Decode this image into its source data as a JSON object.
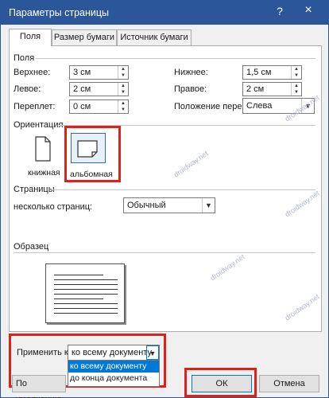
{
  "window": {
    "title": "Параметры страницы",
    "help_glyph": "?",
    "close_glyph": "×"
  },
  "tabs": [
    {
      "label": "Поля",
      "active": true
    },
    {
      "label": "Размер бумаги",
      "active": false
    },
    {
      "label": "Источник бумаги",
      "active": false
    }
  ],
  "margins": {
    "section_label": "Поля",
    "top_label": "Верхнее:",
    "top_value": "3 см",
    "bottom_label": "Нижнее:",
    "bottom_value": "1,5 см",
    "left_label": "Левое:",
    "left_value": "2 см",
    "right_label": "Правое:",
    "right_value": "2 см",
    "gutter_label": "Переплет:",
    "gutter_value": "0 см",
    "gutter_pos_label": "Положение переплета:",
    "gutter_pos_value": "Слева"
  },
  "orientation": {
    "section_label": "Ориентация",
    "portrait_label": "книжная",
    "landscape_label": "альбомная",
    "selected": "landscape"
  },
  "pages": {
    "section_label": "Страницы",
    "multiple_label": "несколько страниц:",
    "multiple_value": "Обычный"
  },
  "preview": {
    "section_label": "Образец"
  },
  "apply": {
    "label": "Применить к:",
    "value": "ко всему документу",
    "options": [
      "ко всему документу",
      "до конца документа"
    ]
  },
  "buttons": {
    "default_label": "По умолчанию",
    "ok_label": "ОК",
    "cancel_label": "Отмена"
  },
  "watermark_text": "droidway.net",
  "colors": {
    "titlebar": "#2b579a",
    "highlight": "#e0201a",
    "selection": "#0078d7"
  }
}
